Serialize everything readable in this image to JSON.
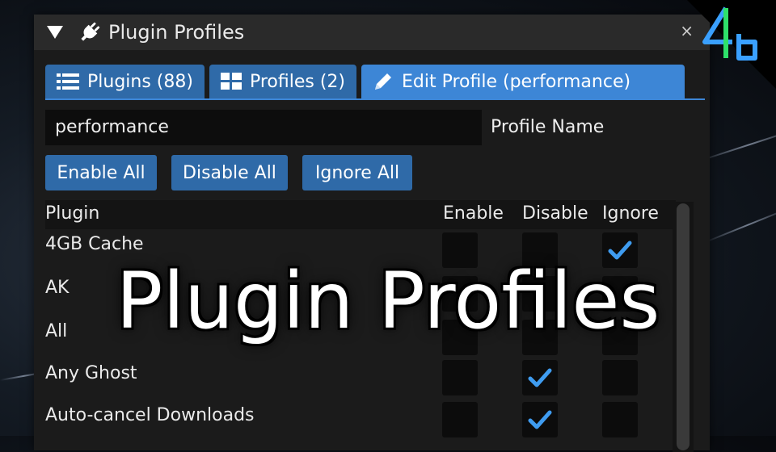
{
  "window": {
    "title": "Plugin Profiles",
    "close_glyph": "×"
  },
  "tabs": [
    {
      "label": "Plugins (88)",
      "icon": "list-icon",
      "active": false
    },
    {
      "label": "Profiles (2)",
      "icon": "grid-icon",
      "active": false
    },
    {
      "label": "Edit Profile (performance)",
      "icon": "pencil-icon",
      "active": true
    }
  ],
  "profile": {
    "name_value": "performance",
    "name_label": "Profile Name"
  },
  "buttons": {
    "enable_all": "Enable All",
    "disable_all": "Disable All",
    "ignore_all": "Ignore All"
  },
  "table": {
    "headers": {
      "plugin": "Plugin",
      "enable": "Enable",
      "disable": "Disable",
      "ignore": "Ignore"
    },
    "rows": [
      {
        "name": "4GB Cache",
        "enable": false,
        "disable": false,
        "ignore": true
      },
      {
        "name": "AK",
        "enable": false,
        "disable": false,
        "ignore": false
      },
      {
        "name": "All",
        "enable": false,
        "disable": false,
        "ignore": false
      },
      {
        "name": "Any Ghost",
        "enable": false,
        "disable": true,
        "ignore": false
      },
      {
        "name": "Auto-cancel Downloads",
        "enable": false,
        "disable": true,
        "ignore": false
      }
    ]
  },
  "overlay": {
    "title": "Plugin Profiles"
  },
  "colors": {
    "tab": "#2f6aa8",
    "tab_active": "#3d86d6",
    "check": "#3f9cf0"
  }
}
